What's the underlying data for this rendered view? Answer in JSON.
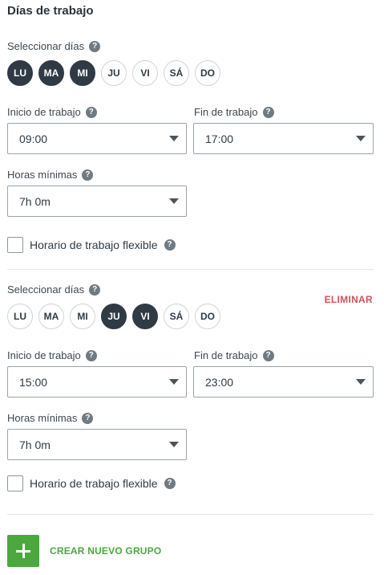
{
  "title": "Días de trabajo",
  "help_glyph": "?",
  "groups": [
    {
      "select_days_label": "Seleccionar días",
      "days": [
        {
          "label": "LU",
          "selected": true
        },
        {
          "label": "MA",
          "selected": true
        },
        {
          "label": "MI",
          "selected": true
        },
        {
          "label": "JU",
          "selected": false
        },
        {
          "label": "VI",
          "selected": false
        },
        {
          "label": "SÁ",
          "selected": false
        },
        {
          "label": "DO",
          "selected": false
        }
      ],
      "remove_label": "",
      "start_label": "Inicio de trabajo",
      "start_value": "09:00",
      "end_label": "Fin de trabajo",
      "end_value": "17:00",
      "min_hours_label": "Horas mínimas",
      "min_hours_value": "7h 0m",
      "flexible_label": "Horario de trabajo flexible",
      "flexible_checked": false
    },
    {
      "select_days_label": "Seleccionar días",
      "days": [
        {
          "label": "LU",
          "selected": false
        },
        {
          "label": "MA",
          "selected": false
        },
        {
          "label": "MI",
          "selected": false
        },
        {
          "label": "JU",
          "selected": true
        },
        {
          "label": "VI",
          "selected": true
        },
        {
          "label": "SÁ",
          "selected": false
        },
        {
          "label": "DO",
          "selected": false
        }
      ],
      "remove_label": "ELIMINAR",
      "start_label": "Inicio de trabajo",
      "start_value": "15:00",
      "end_label": "Fin de trabajo",
      "end_value": "23:00",
      "min_hours_label": "Horas mínimas",
      "min_hours_value": "7h 0m",
      "flexible_label": "Horario de trabajo flexible",
      "flexible_checked": false
    }
  ],
  "create_group_label": "CREAR NUEVO GRUPO",
  "colors": {
    "selected_day": "#2f3a44",
    "accent_green": "#4aa83f",
    "remove_red": "#d4515a"
  }
}
